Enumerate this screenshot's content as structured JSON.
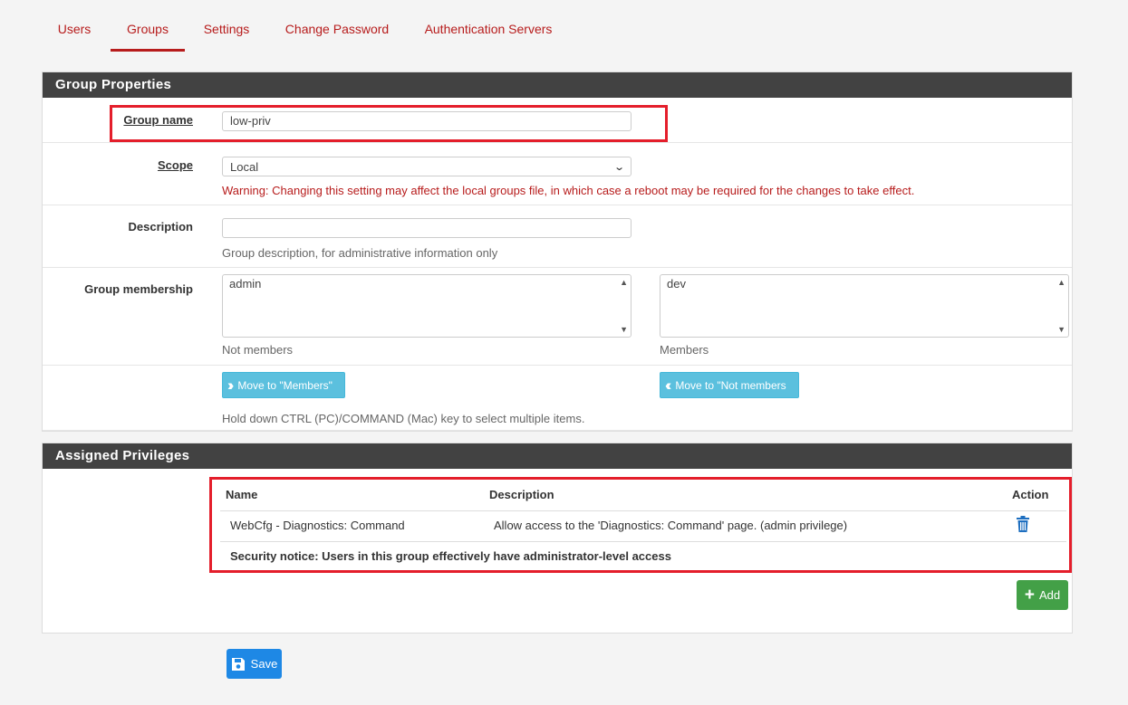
{
  "tabs": [
    "Users",
    "Groups",
    "Settings",
    "Change Password",
    "Authentication Servers"
  ],
  "active_tab": "Groups",
  "group_properties": {
    "heading": "Group Properties",
    "group_name": {
      "label": "Group name",
      "value": "low-priv"
    },
    "scope": {
      "label": "Scope",
      "value": "Local",
      "warning": "Warning: Changing this setting may affect the local groups file, in which case a reboot may be required for the changes to take effect."
    },
    "description": {
      "label": "Description",
      "value": "",
      "help": "Group description, for administrative information only"
    },
    "membership": {
      "label": "Group membership",
      "not_members": {
        "items": [
          "admin"
        ],
        "caption": "Not members"
      },
      "members": {
        "items": [
          "dev"
        ],
        "caption": "Members"
      },
      "move_to_members_label": "Move to \"Members\"",
      "move_to_not_members_label": "Move to \"Not members",
      "hint": "Hold down CTRL (PC)/COMMAND (Mac) key to select multiple items."
    }
  },
  "assigned_privileges": {
    "heading": "Assigned Privileges",
    "columns": {
      "name": "Name",
      "description": "Description",
      "action": "Action"
    },
    "rows": [
      {
        "name": "WebCfg - Diagnostics: Command",
        "description": "Allow access to the 'Diagnostics: Command' page. (admin privilege)",
        "action_icon": "trash-icon"
      }
    ],
    "security_notice": "Security notice: Users in this group effectively have administrator-level access",
    "add_label": "Add"
  },
  "save_label": "Save",
  "colors": {
    "accent": "#b71c1c",
    "heading_bg": "#424242",
    "info_button": "#5bc0de",
    "success_button": "#43a047",
    "primary_button": "#1e88e5",
    "highlight": "#e41e2b"
  }
}
